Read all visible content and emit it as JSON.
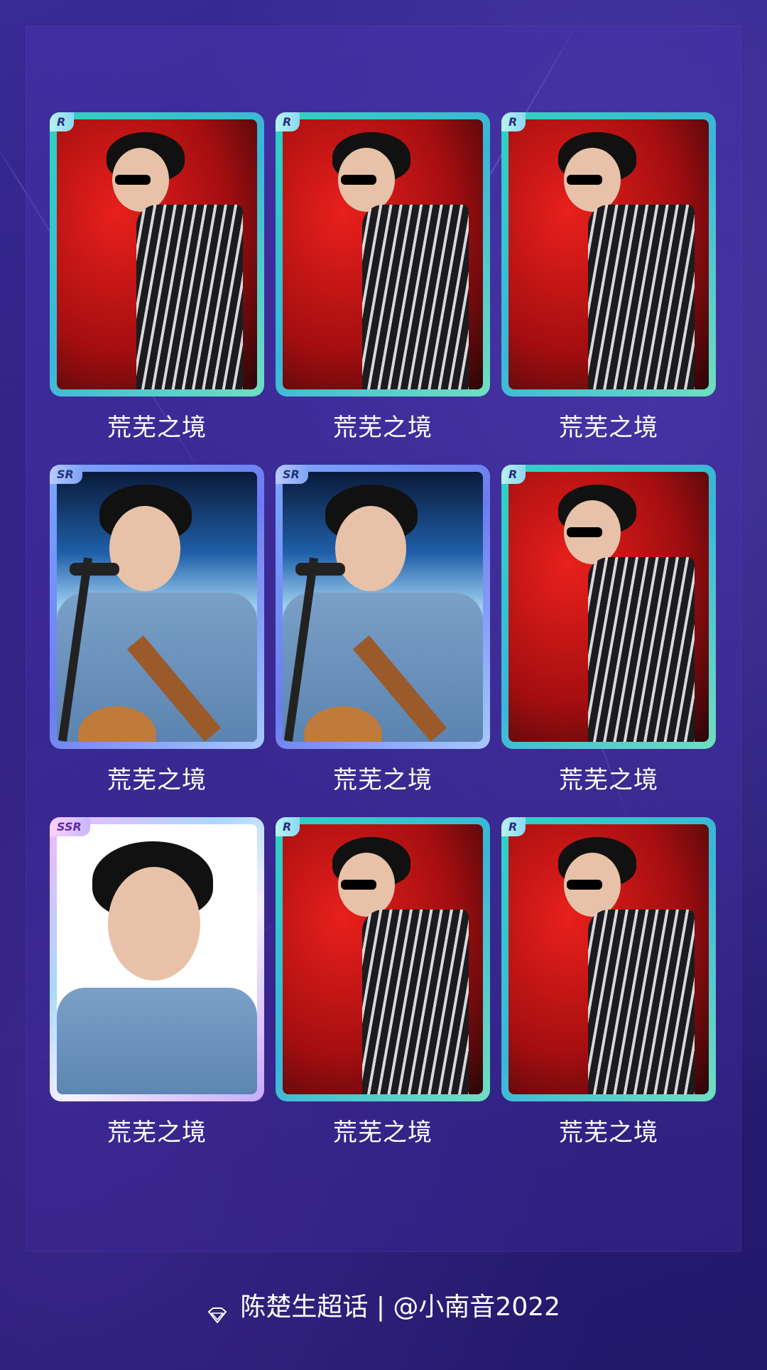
{
  "cards": [
    {
      "rarity": "R",
      "caption": "荒芜之境",
      "photo": "stage-red"
    },
    {
      "rarity": "R",
      "caption": "荒芜之境",
      "photo": "stage-red"
    },
    {
      "rarity": "R",
      "caption": "荒芜之境",
      "photo": "stage-red"
    },
    {
      "rarity": "SR",
      "caption": "荒芜之境",
      "photo": "guitar-blue"
    },
    {
      "rarity": "SR",
      "caption": "荒芜之境",
      "photo": "guitar-blue"
    },
    {
      "rarity": "R",
      "caption": "荒芜之境",
      "photo": "stage-red"
    },
    {
      "rarity": "SSR",
      "caption": "荒芜之境",
      "photo": "portrait-white"
    },
    {
      "rarity": "R",
      "caption": "荒芜之境",
      "photo": "stage-red"
    },
    {
      "rarity": "R",
      "caption": "荒芜之境",
      "photo": "stage-red"
    }
  ],
  "footer": {
    "icon": "diamond-icon",
    "text": "陈楚生超话 | @小南音2022"
  },
  "colors": {
    "background": "#2e1f7a",
    "r_frame": "#2fd3c2",
    "sr_frame": "#7aa7ff",
    "ssr_frame": "#f2b8ff"
  }
}
